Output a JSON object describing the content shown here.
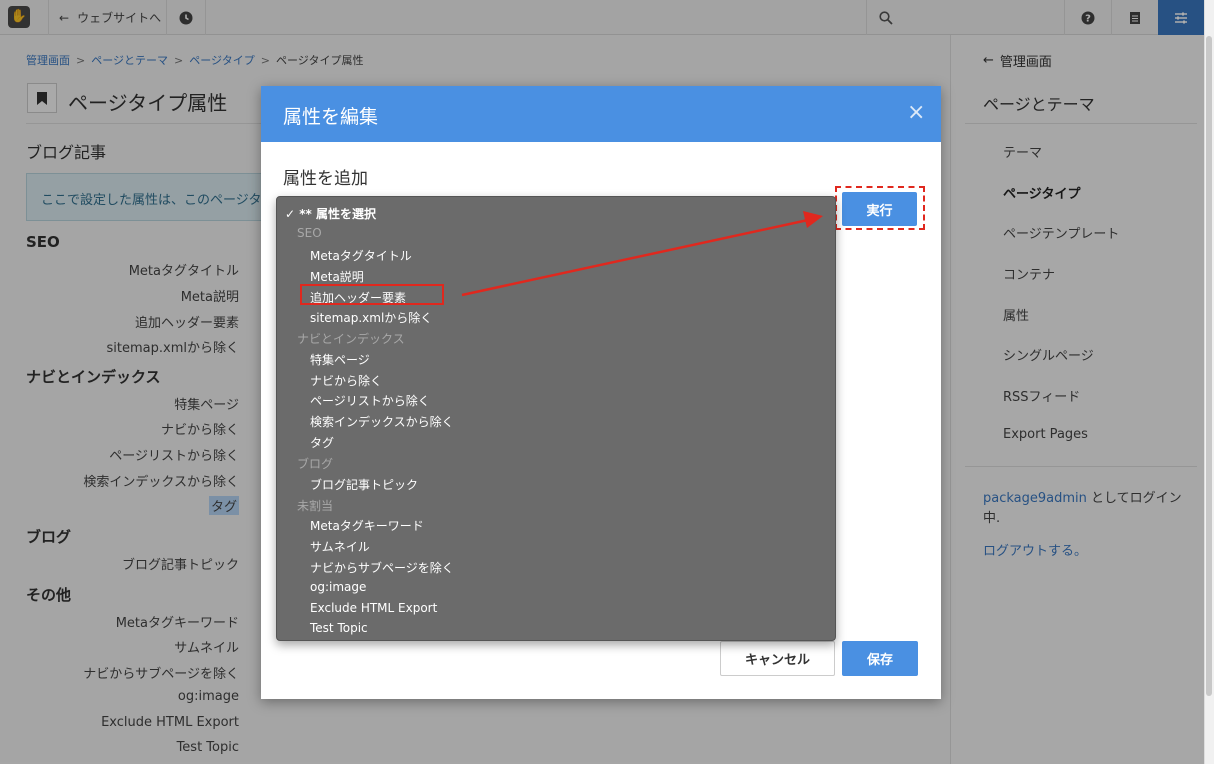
{
  "toolbar": {
    "back_label": "ウェブサイトへ"
  },
  "breadcrumb": [
    "管理画面",
    "ページとテーマ",
    "ページタイプ",
    "ページタイプ属性"
  ],
  "breadcrumb_sep": ">",
  "page": {
    "title": "ページタイプ属性",
    "subtitle": "ブログ記事",
    "notice": "ここで設定した属性は、このページタ"
  },
  "groups": [
    {
      "name": "SEO",
      "items": [
        "Metaタグタイトル",
        "Meta説明",
        "追加ヘッダー要素",
        "sitemap.xmlから除く"
      ]
    },
    {
      "name": "ナビとインデックス",
      "items": [
        "特集ページ",
        "ナビから除く",
        "ページリストから除く",
        "検索インデックスから除く",
        "タグ"
      ]
    },
    {
      "name": "ブログ",
      "items": [
        "ブログ記事トピック"
      ]
    },
    {
      "name": "その他",
      "items": [
        "Metaタグキーワード",
        "サムネイル",
        "ナビからサブページを除く",
        "og:image",
        "Exclude HTML Export",
        "Test Topic"
      ]
    }
  ],
  "sidebar": {
    "back_label": "管理画面",
    "title": "ページとテーマ",
    "items": [
      "テーマ",
      "ページタイプ",
      "ページテンプレート",
      "コンテナ",
      "属性",
      "シングルページ",
      "RSSフィード",
      "Export Pages"
    ],
    "active_index": 1,
    "login_user": "package9admin",
    "login_text": "としてログイン中.",
    "logout": "ログアウトする。"
  },
  "modal": {
    "title": "属性を編集",
    "close": "×",
    "subtitle": "属性を追加",
    "run_button": "実行",
    "cancel_button": "キャンセル",
    "save_button": "保存"
  },
  "dropdown": {
    "selected": "✓ ** 属性を選択",
    "groups": [
      {
        "label": "SEO",
        "options": [
          "Metaタグタイトル",
          "Meta説明",
          "追加ヘッダー要素",
          "sitemap.xmlから除く"
        ]
      },
      {
        "label": "ナビとインデックス",
        "options": [
          "特集ページ",
          "ナビから除く",
          "ページリストから除く",
          "検索インデックスから除く",
          "タグ"
        ]
      },
      {
        "label": "ブログ",
        "options": [
          "ブログ記事トピック"
        ]
      },
      {
        "label": "未割当",
        "options": [
          "Metaタグキーワード",
          "サムネイル",
          "ナビからサブページを除く",
          "og:image",
          "Exclude HTML Export",
          "Test Topic"
        ]
      }
    ],
    "highlighted_option": "追加ヘッダー要素"
  },
  "colors": {
    "accent": "#4a90e2",
    "annotation": "#e0281e"
  }
}
